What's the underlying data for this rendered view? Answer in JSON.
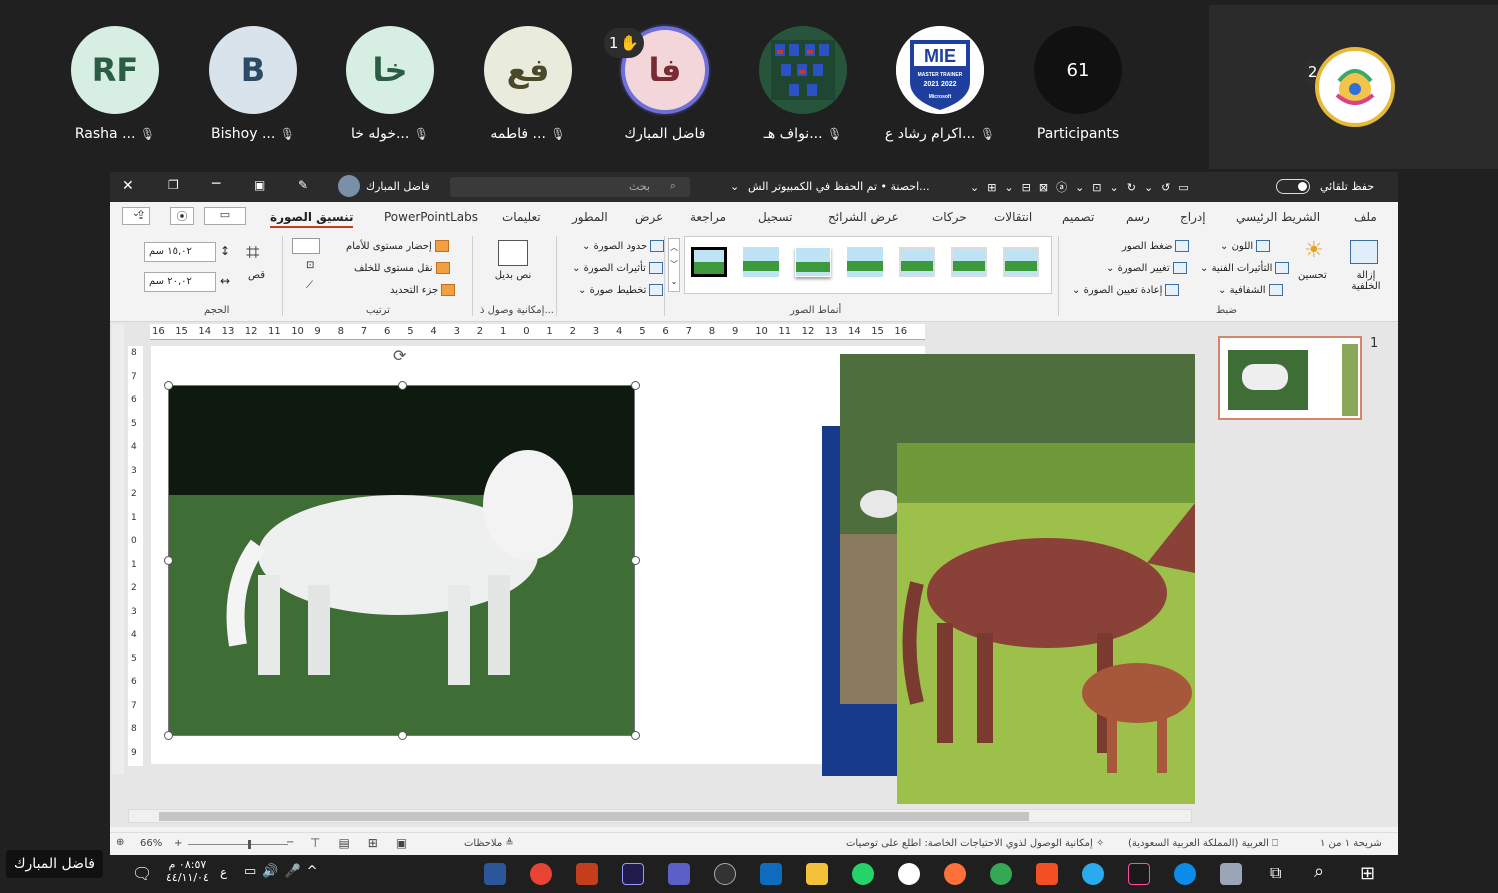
{
  "participants": [
    {
      "initials": "RF",
      "name": "Rasha ...",
      "bg": "#d7efe3"
    },
    {
      "initials": "B",
      "name": "Bishoy ...",
      "bg": "#d8e3ec"
    },
    {
      "initials": "خا",
      "name": "خوله خا...",
      "bg": "#d7efe3"
    },
    {
      "initials": "فع",
      "name": "فاطمه ...",
      "bg": "#e9ecdd"
    },
    {
      "initials": "فا",
      "name": "فاضل المبارك",
      "bg": "#f3d6da"
    },
    {
      "initials": "",
      "name": "نواف هـ...",
      "bg": "#1b3a2a"
    },
    {
      "initials": "MIE",
      "name": "اكرام رشاد ع...",
      "bg": "#ffffff"
    },
    {
      "initials": "61",
      "name": "Participants",
      "bg": "#111111"
    }
  ],
  "hand_raises": {
    "first": "1",
    "second": "2"
  },
  "mie": {
    "sub": "MASTER TRAINER",
    "years": "2021 2022",
    "brand": "Microsoft"
  },
  "window": {
    "autosave": "حفظ تلقائي",
    "doc_title": "احصنة • تم الحفظ في الكمبيوتر الش...",
    "search_placeholder": "بحث",
    "user": "فاضل المبارك"
  },
  "tabs": [
    "ملف",
    "الشريط الرئيسي",
    "إدراج",
    "رسم",
    "تصميم",
    "انتقالات",
    "حركات",
    "عرض الشرائح",
    "تسجيل",
    "مراجعة",
    "عرض",
    "المطور",
    "تعليمات",
    "PowerPointLabs",
    "تنسيق الصورة"
  ],
  "ribbon": {
    "remove_bg": "إزالة الخلفية",
    "corrections": "تحسين",
    "color": "اللون",
    "artistic": "التأثيرات الفنية",
    "transparency": "الشفافية",
    "compress": "ضغط الصور",
    "change": "تغيير الصورة",
    "reset": "إعادة تعيين الصورة",
    "adjust_group": "ضبط",
    "styles_group": "أنماط الصور",
    "border": "حدود الصورة",
    "effects": "تأثيرات الصورة",
    "layout": "تخطيط صورة",
    "alt_text": "نص بديل",
    "access_group": "إمكانية وصول ذ...",
    "bring_forward": "إحضار مستوى للأمام",
    "send_backward": "نقل مستوى للخلف",
    "selection_pane": "جزء التحديد",
    "arrange_group": "ترتيب",
    "crop": "قص",
    "height": "١٥,٠٢ سم",
    "width": "٢٠,٠٢ سم",
    "size_group": "الحجم"
  },
  "ruler_h": [
    "16",
    "15",
    "14",
    "13",
    "12",
    "11",
    "10",
    "9",
    "8",
    "7",
    "6",
    "5",
    "4",
    "3",
    "2",
    "1",
    "0",
    "1",
    "2",
    "3",
    "4",
    "5",
    "6",
    "7",
    "8",
    "9",
    "10",
    "11",
    "12",
    "13",
    "14",
    "15",
    "16"
  ],
  "ruler_v": [
    "8",
    "7",
    "6",
    "5",
    "4",
    "3",
    "2",
    "1",
    "0",
    "1",
    "2",
    "3",
    "4",
    "5",
    "6",
    "7",
    "8",
    "9"
  ],
  "thumb_number": "1",
  "status": {
    "slide": "شريحة ١ من ١",
    "lang": "العربية (المملكة العربية السعودية)",
    "access": "إمكانية الوصول لذوي الاحتياجات الخاصة: اطلع على توصيات",
    "notes": "ملاحظات",
    "zoom": "66%"
  },
  "taskbar": {
    "time": "٠٨:٥٧ م",
    "date": "٤٤/١١/٠٤",
    "lang": "ع"
  },
  "speaker": "فاضل المبارك"
}
